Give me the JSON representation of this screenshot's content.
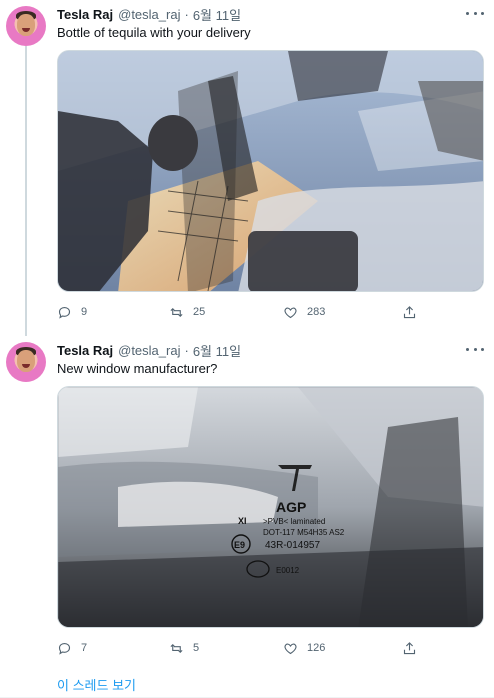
{
  "tweets": [
    {
      "author_name": "Tesla Raj",
      "handle": "@tesla_raj",
      "separator": "·",
      "date": "6월 11일",
      "text": "Bottle of tequila with your delivery",
      "replies": "9",
      "retweets": "25",
      "likes": "283"
    },
    {
      "author_name": "Tesla Raj",
      "handle": "@tesla_raj",
      "separator": "·",
      "date": "6월 11일",
      "text": "New window manufacturer?",
      "replies": "7",
      "retweets": "5",
      "likes": "126",
      "media_text": {
        "brand": "AGP",
        "line1": ">PVB< laminated",
        "line2": "DOT-117 M54H35 AS2",
        "line3": "43R-014957",
        "prefix": "XI",
        "e_mark": "E9",
        "ccc_text": "E0012"
      }
    }
  ],
  "show_thread_label": "이 스레드 보기",
  "icons": {
    "reply": "reply-icon",
    "retweet": "retweet-icon",
    "like": "heart-icon",
    "share": "share-icon",
    "more": "more-icon"
  },
  "colors": {
    "link": "#1d9bf0",
    "secondary_text": "#536471",
    "primary_text": "#0f1419"
  }
}
